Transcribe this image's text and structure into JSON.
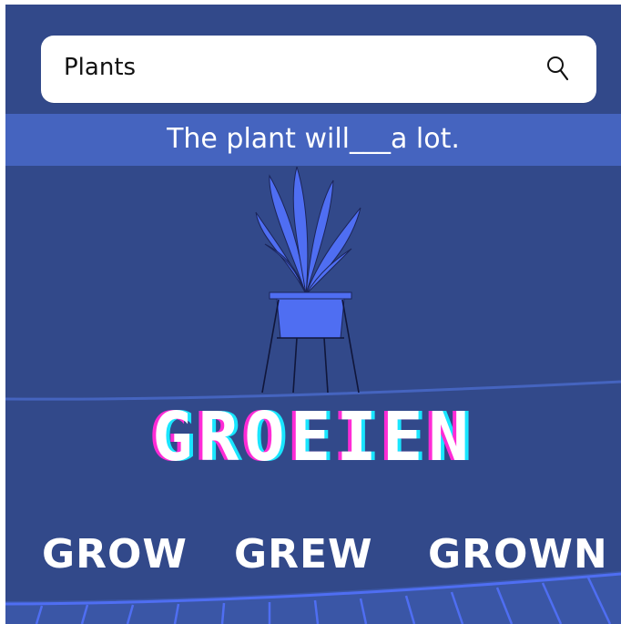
{
  "search": {
    "value": "Plants",
    "icon": "search-icon"
  },
  "banner": {
    "sentence": "The plant will___a lot."
  },
  "title": {
    "text": "GROEIEN"
  },
  "options": [
    {
      "label": "GROW"
    },
    {
      "label": "GREW"
    },
    {
      "label": "GROWN"
    }
  ],
  "colors": {
    "background": "#32498a",
    "banner": "#4564bf",
    "plant": "#4f6ef2",
    "title_magenta": "#ff2bd6",
    "title_cyan": "#19e6ff"
  }
}
